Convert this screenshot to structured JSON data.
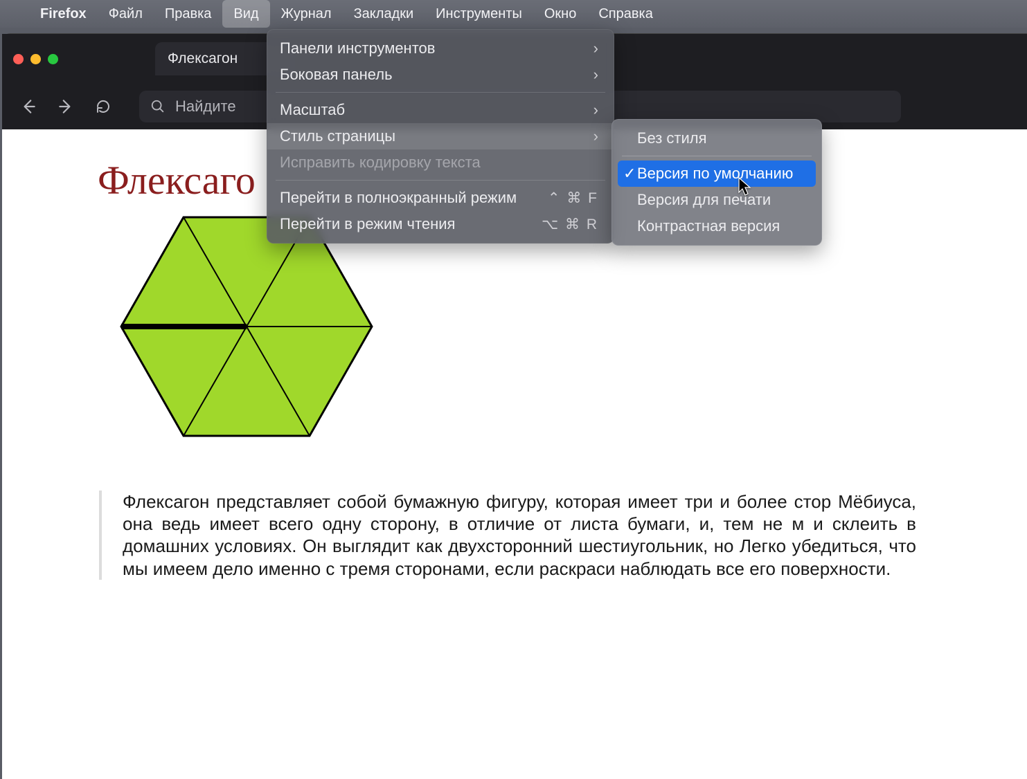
{
  "menubar": {
    "app": "Firefox",
    "items": [
      "Файл",
      "Правка",
      "Вид",
      "Журнал",
      "Закладки",
      "Инструменты",
      "Окно",
      "Справка"
    ],
    "active_index": 2
  },
  "browser": {
    "tab_title": "Флексагон",
    "search_placeholder": "Найдите"
  },
  "page": {
    "heading": "Флексаго",
    "paragraph": "Флексагон представляет собой бумажную фигуру, которая имеет три и более стор Мёбиуса, она ведь имеет всего одну сторону, в отличие от листа бумаги, и, тем не м и склеить в домашних условиях. Он выглядит как двухсторонний шестиугольник, но Легко убедиться, что мы имеем дело именно с тремя сторонами, если раскраси наблюдать все его поверхности."
  },
  "view_menu": {
    "items": [
      {
        "label": "Панели инструментов",
        "submenu": true
      },
      {
        "label": "Боковая панель",
        "submenu": true
      },
      {
        "sep": true
      },
      {
        "label": "Масштаб",
        "submenu": true
      },
      {
        "label": "Стиль страницы",
        "submenu": true,
        "highlight": true
      },
      {
        "label": "Исправить кодировку текста",
        "disabled": true
      },
      {
        "sep": true
      },
      {
        "label": "Перейти в полноэкранный режим",
        "shortcut": "⌃ ⌘ F"
      },
      {
        "label": "Перейти в режим чтения",
        "shortcut": "⌥ ⌘ R"
      }
    ]
  },
  "style_submenu": {
    "items": [
      {
        "label": "Без стиля"
      },
      {
        "sep": true
      },
      {
        "label": "Версия по умолчанию",
        "checked": true,
        "selected": true
      },
      {
        "label": "Версия для печати"
      },
      {
        "label": "Контрастная версия"
      }
    ]
  },
  "hexagon": {
    "fill": "#a0d82b",
    "stroke": "#000000"
  }
}
